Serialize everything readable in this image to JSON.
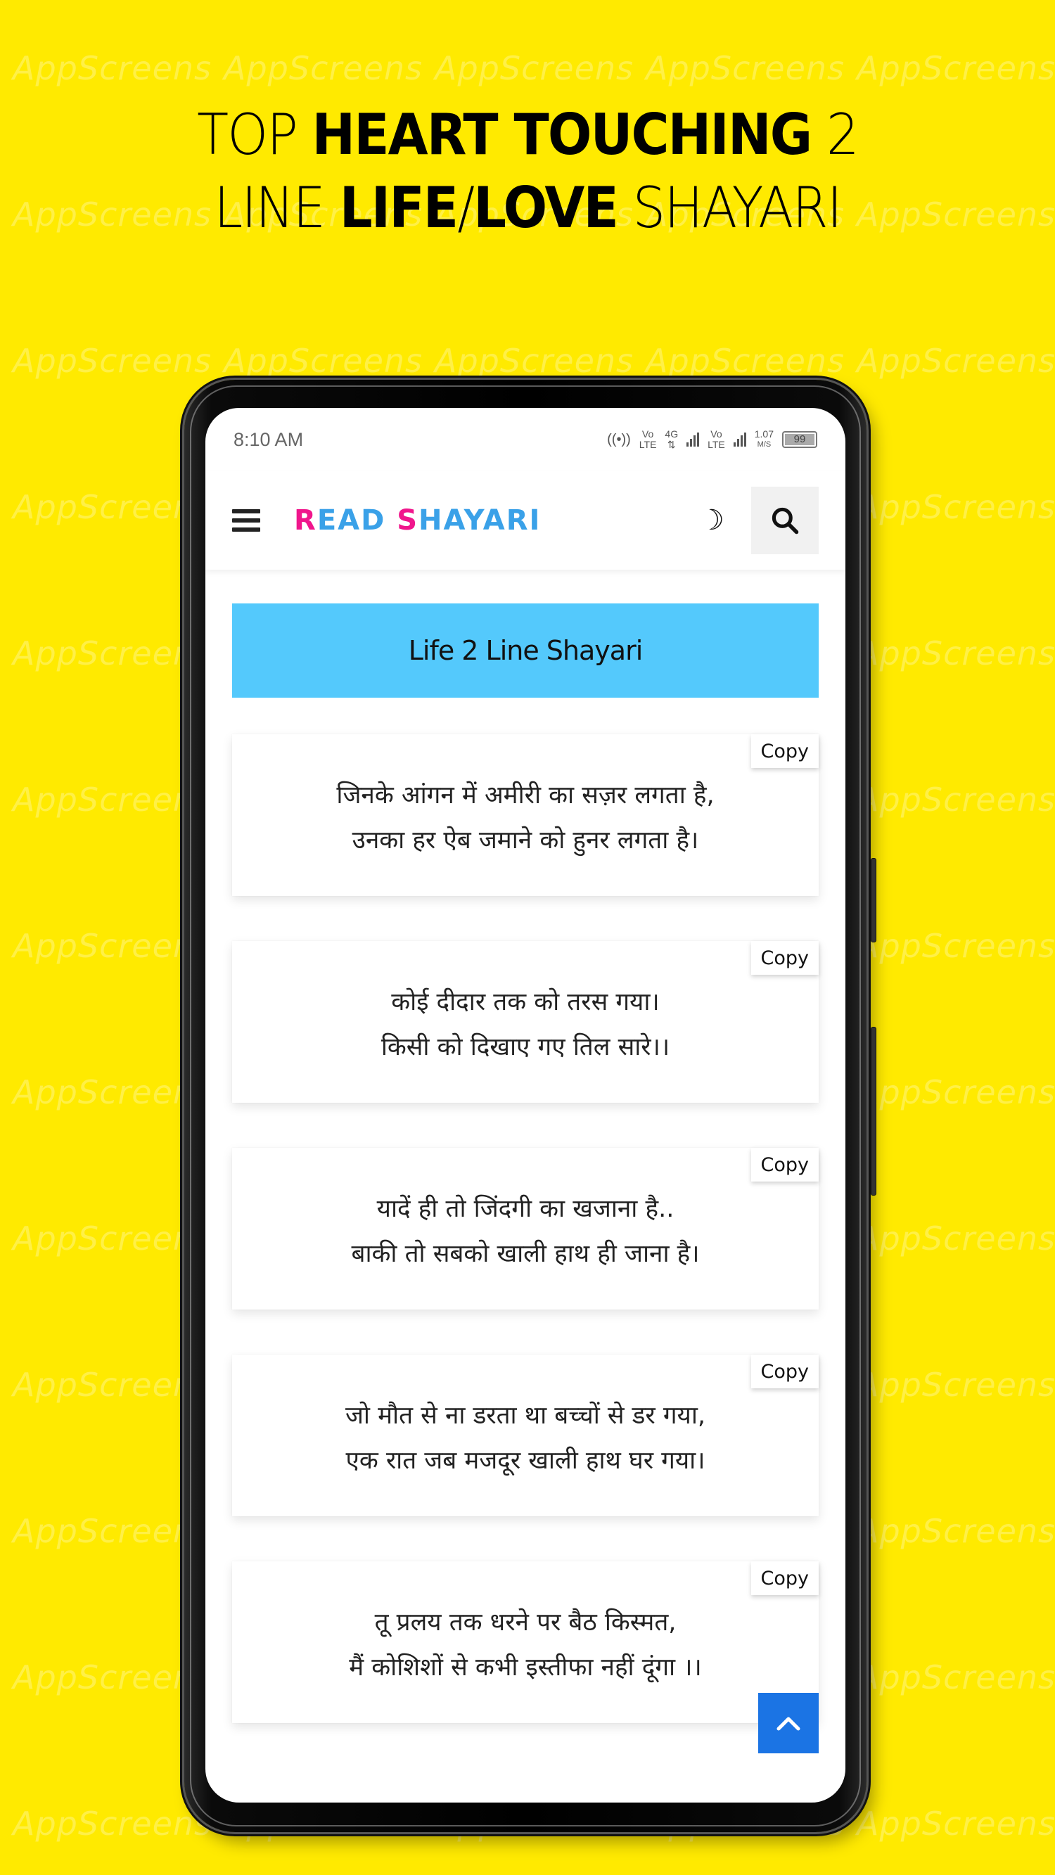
{
  "watermark": "AppScreens",
  "headline": {
    "line1": [
      {
        "text": "TOP ",
        "weight": "thin"
      },
      {
        "text": "HEART TOUCHING",
        "weight": "bold"
      },
      {
        "text": " 2",
        "weight": "thin"
      }
    ],
    "line2": [
      {
        "text": "LINE ",
        "weight": "thin"
      },
      {
        "text": "LIFE",
        "weight": "bold"
      },
      {
        "text": "/",
        "weight": "thin"
      },
      {
        "text": "LOVE",
        "weight": "bold"
      },
      {
        "text": " SHAYARI",
        "weight": "thin"
      }
    ]
  },
  "statusbar": {
    "time": "8:10 AM",
    "hotspot_icon": "hotspot-icon",
    "sim1_label_top": "Vo",
    "sim1_label_bottom": "LTE",
    "network_label": "4G",
    "sim2_label_top": "Vo",
    "sim2_label_bottom": "LTE",
    "speed_value": "1.07",
    "speed_unit": "M/S",
    "battery": "99"
  },
  "appbar": {
    "menu_icon": "hamburger-menu-icon",
    "logo_first_letter": "R",
    "logo_rest1": "EAD ",
    "logo_second_letter": "S",
    "logo_rest2": "HAYARI",
    "theme_icon": "moon-icon",
    "search_icon": "search-icon"
  },
  "colors": {
    "background": "#FFEA00",
    "logo_pink": "#F0168C",
    "logo_blue": "#3AA1E8",
    "section_bg": "#54C9FC",
    "scroll_top_bg": "#1B74E4"
  },
  "section": {
    "title": "Life 2 Line Shayari"
  },
  "cards": [
    {
      "line1": "जिनके आंगन में अमीरी का सज़र लगता है,",
      "line2": "उनका हर ऐब जमाने को हुनर लगता है।",
      "copy_label": "Copy"
    },
    {
      "line1": "कोई दीदार तक को तरस गया।",
      "line2": "किसी को दिखाए गए तिल सारे।।",
      "copy_label": "Copy"
    },
    {
      "line1": "यादें ही तो जिंदगी का खजाना है..",
      "line2": "बाकी तो सबको खाली हाथ ही जाना है।",
      "copy_label": "Copy"
    },
    {
      "line1": "जो मौत से ना डरता था बच्चों से डर गया,",
      "line2": "एक रात जब मजदूर खाली हाथ घर गया।",
      "copy_label": "Copy"
    },
    {
      "line1": "तू प्रलय तक धरने पर बैठ किस्मत,",
      "line2": "मैं कोशिशों से कभी इस्तीफा नहीं दूंगा ।।",
      "copy_label": "Copy"
    }
  ],
  "scroll_top": {
    "icon": "chevron-up-icon",
    "glyph": "^"
  }
}
